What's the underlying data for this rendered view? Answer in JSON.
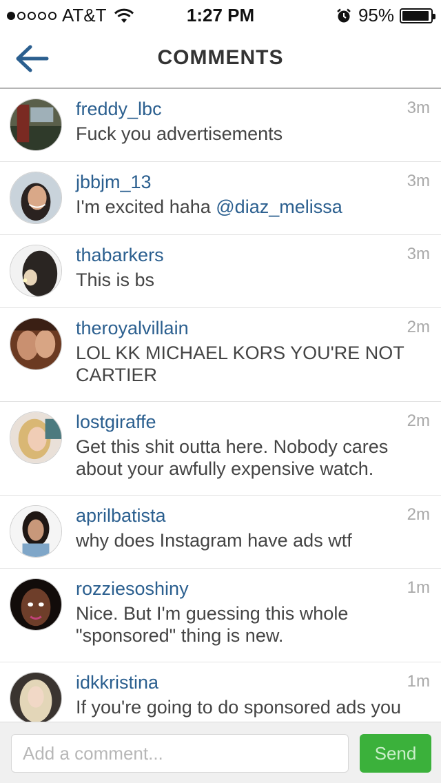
{
  "status_bar": {
    "carrier": "AT&T",
    "time": "1:27 PM",
    "battery_percent": "95%",
    "signal_bars_filled": 1,
    "signal_bars_total": 5,
    "battery_level": 0.95
  },
  "nav": {
    "title": "COMMENTS",
    "back_icon": "back-arrow-icon"
  },
  "colors": {
    "username": "#2b5f8f",
    "send_button": "#3bb13b",
    "divider": "#e3e3e3"
  },
  "comments": [
    {
      "user": "freddy_lbc",
      "time": "3m",
      "text": "Fuck you advertisements"
    },
    {
      "user": "jbbjm_13",
      "time": "3m",
      "text": "I'm excited haha ",
      "mention": "@diaz_melissa"
    },
    {
      "user": "thabarkers",
      "time": "3m",
      "text": "This is bs"
    },
    {
      "user": "theroyalvillain",
      "time": "2m",
      "text": "LOL KK MICHAEL KORS YOU'RE NOT CARTIER"
    },
    {
      "user": "lostgiraffe",
      "time": "2m",
      "text": "Get this shit outta here. Nobody cares about your awfully expensive watch."
    },
    {
      "user": "aprilbatista",
      "time": "2m",
      "text": "why does Instagram have ads wtf"
    },
    {
      "user": "rozziesoshiny",
      "time": "1m",
      "text": "Nice. But I'm guessing this whole \"sponsored\" thing is new."
    },
    {
      "user": "idkkristina",
      "time": "1m",
      "text": "If you're going to do sponsored ads you"
    }
  ],
  "composer": {
    "placeholder": "Add a comment...",
    "send_label": "Send"
  }
}
